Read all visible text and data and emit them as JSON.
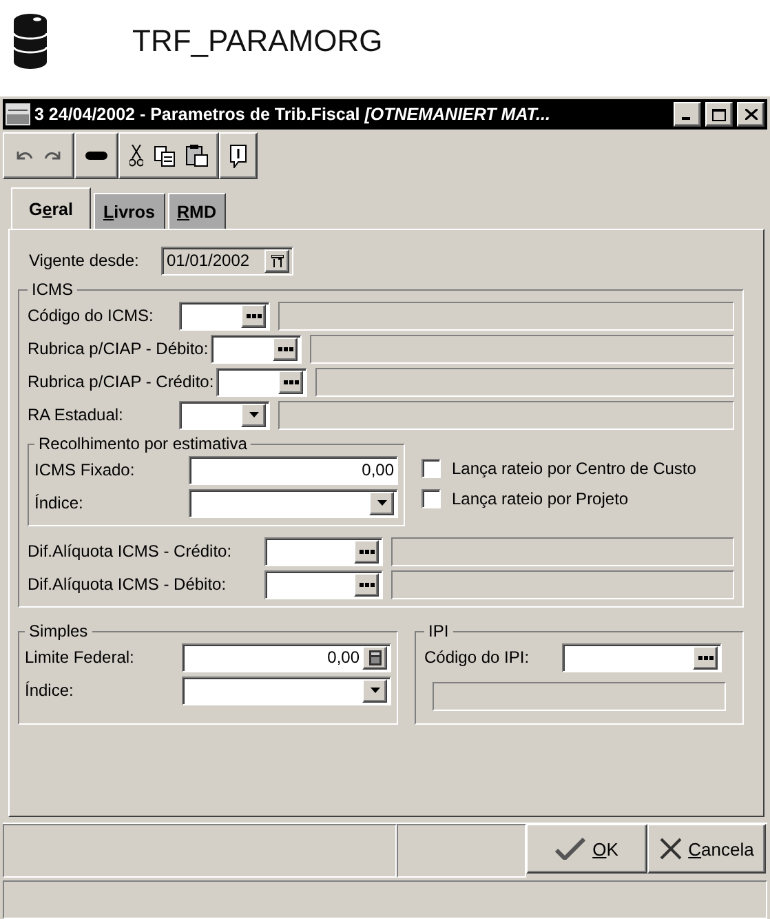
{
  "header": {
    "title": "TRF_PARAMORG"
  },
  "window": {
    "title": "3 24/04/2002 -  Parametros de Trib.Fiscal *[OTNEMANIERT MAT...*"
  },
  "tabs": [
    {
      "before": "G",
      "key": "e",
      "after": "ral",
      "selected": true
    },
    {
      "key": "L",
      "after": "ivros",
      "selected": false
    },
    {
      "key": "R",
      "after": "MD",
      "selected": false
    }
  ],
  "vigente": {
    "kind": "date",
    "label": "Vigente desde:",
    "value": "01/01/2002"
  },
  "icms": {
    "title": "ICMS",
    "rows": [
      {
        "kind": "lookup",
        "label": "Código do ICMS:"
      },
      {
        "kind": "lookup",
        "label": "Rubrica p/CIAP - Débito:"
      },
      {
        "kind": "lookup",
        "label": "Rubrica p/CIAP - Crédito:"
      },
      {
        "kind": "combo",
        "label": "RA Estadual:"
      }
    ],
    "estimativa": {
      "title": "Recolhimento por estimativa",
      "rows": [
        {
          "kind": "number",
          "label": "ICMS Fixado:",
          "value": "0,00"
        },
        {
          "kind": "dropdown",
          "label": "Índice:"
        }
      ]
    },
    "checkboxes": [
      {
        "label": "Lança rateio por Centro de Custo",
        "checked": false
      },
      {
        "label": "Lança rateio por Projeto",
        "checked": false
      }
    ],
    "dif_rows": [
      {
        "kind": "lookup",
        "label": "Dif.Alíquota ICMS - Crédito:"
      },
      {
        "kind": "lookup",
        "label": "Dif.Alíquota ICMS - Débito:"
      }
    ]
  },
  "simples": {
    "title": "Simples",
    "rows": [
      {
        "kind": "calc",
        "label": "Limite Federal:",
        "value": "0,00"
      },
      {
        "kind": "dropdown",
        "label": "Índice:"
      }
    ]
  },
  "ipi": {
    "title": "IPI",
    "rows": [
      {
        "kind": "lookup_stacked",
        "label": "Código do IPI:"
      }
    ]
  },
  "buttons": [
    {
      "kind": "ok",
      "key": "O",
      "after": "K"
    },
    {
      "kind": "cancel",
      "key": "C",
      "after": "ancela"
    }
  ]
}
